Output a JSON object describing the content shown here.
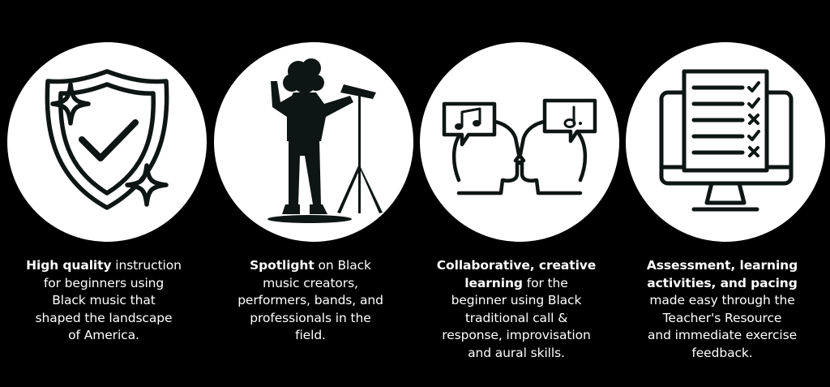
{
  "colors": {
    "background": "#000000",
    "circle": "#ffffff",
    "icon": "#0d1614",
    "text": "#ffffff"
  },
  "features": [
    {
      "icon": "shield-check-sparkle-icon",
      "lines": [
        {
          "bold": "High quality",
          "rest": " instruction"
        },
        {
          "bold": "",
          "rest": "for beginners using"
        },
        {
          "bold": "",
          "rest": "Black music that"
        },
        {
          "bold": "",
          "rest": "shaped the landscape"
        },
        {
          "bold": "",
          "rest": "of America."
        }
      ]
    },
    {
      "icon": "conductor-silhouette-icon",
      "lines": [
        {
          "bold": "Spotlight",
          "rest": " on Black"
        },
        {
          "bold": "",
          "rest": "music creators,"
        },
        {
          "bold": "",
          "rest": "performers, bands, and"
        },
        {
          "bold": "",
          "rest": "professionals in the"
        },
        {
          "bold": "",
          "rest": "field."
        }
      ]
    },
    {
      "icon": "call-and-response-heads-icon",
      "lines": [
        {
          "bold": "Collaborative, creative",
          "rest": ""
        },
        {
          "bold": "learning",
          "rest": " for the"
        },
        {
          "bold": "",
          "rest": "beginner using Black"
        },
        {
          "bold": "",
          "rest": "traditional call &"
        },
        {
          "bold": "",
          "rest": "response, improvisation"
        },
        {
          "bold": "",
          "rest": "and aural skills."
        }
      ]
    },
    {
      "icon": "monitor-checklist-icon",
      "lines": [
        {
          "bold": "Assessment, learning",
          "rest": ""
        },
        {
          "bold": "activities, and pacing",
          "rest": ""
        },
        {
          "bold": "",
          "rest": "made easy through the"
        },
        {
          "bold": "",
          "rest": "Teacher's Resource"
        },
        {
          "bold": "",
          "rest": "and immediate exercise"
        },
        {
          "bold": "",
          "rest": "feedback."
        }
      ]
    }
  ]
}
